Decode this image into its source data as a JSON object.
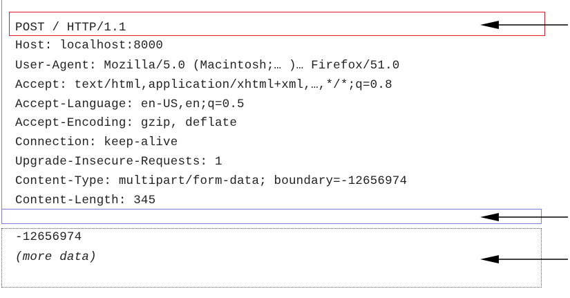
{
  "request_line": "POST / HTTP/1.1",
  "headers": [
    "Host: localhost:8000",
    "User-Agent: Mozilla/5.0 (Macintosh;… )… Firefox/51.0",
    "Accept: text/html,application/xhtml+xml,…,*/*;q=0.8",
    "Accept-Language: en-US,en;q=0.5",
    "Accept-Encoding: gzip, deflate",
    "Connection: keep-alive",
    "Upgrade-Insecure-Requests: 1",
    "Content-Type: multipart/form-data; boundary=-12656974",
    "Content-Length: 345"
  ],
  "body": {
    "boundary_line": "-12656974",
    "more_data": "(more data)"
  },
  "colors": {
    "request_line_box": "#e01b24",
    "blank_line_box": "#7d7dd6",
    "body_box": "#555555",
    "arrow": "#000000"
  }
}
